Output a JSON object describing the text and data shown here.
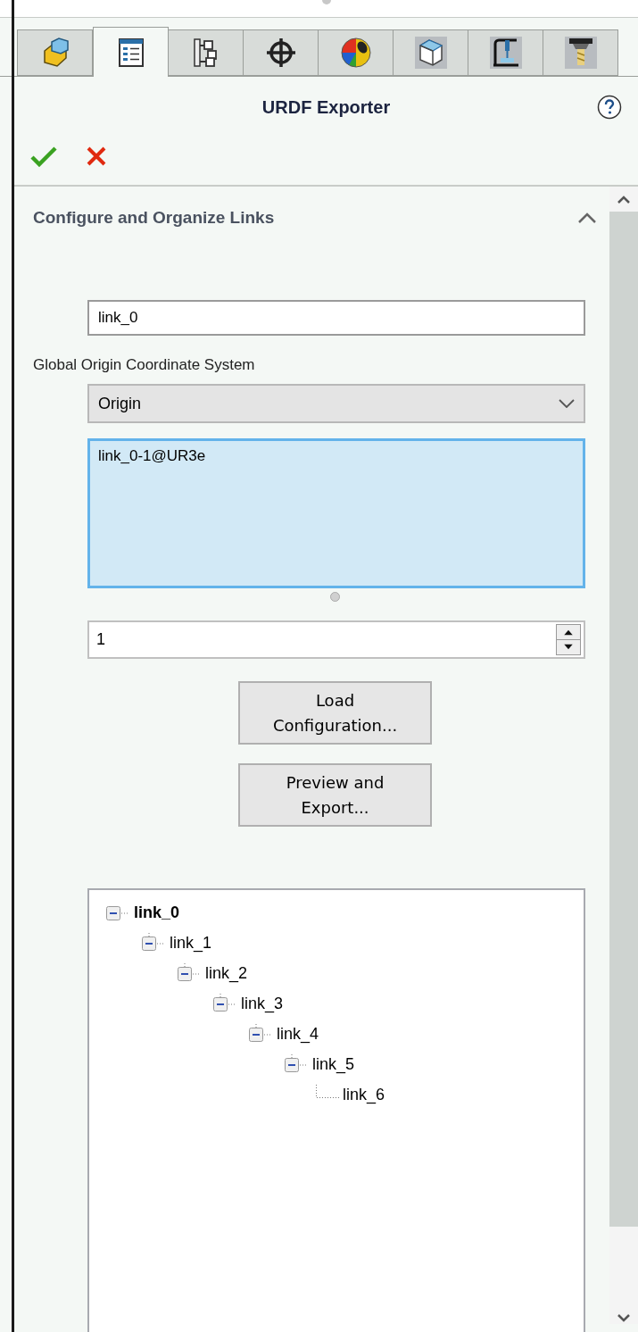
{
  "tabs": [
    {
      "kind": "part",
      "selected": false
    },
    {
      "kind": "property",
      "selected": true
    },
    {
      "kind": "config",
      "selected": false
    },
    {
      "kind": "crosshair",
      "selected": false
    },
    {
      "kind": "appearance",
      "selected": false
    },
    {
      "kind": "cube",
      "selected": false
    },
    {
      "kind": "press",
      "selected": false
    },
    {
      "kind": "drill",
      "selected": false
    }
  ],
  "panel": {
    "title": "URDF Exporter"
  },
  "section": {
    "title": "Configure and Organize Links",
    "expanded": true,
    "link_name": "link_0",
    "origin_label": "Global Origin Coordinate System",
    "origin_select": "Origin",
    "components": [
      "link_0-1@UR3e"
    ],
    "count": "1",
    "buttons": [
      "Load Configuration...",
      "Preview and Export..."
    ],
    "tree": [
      {
        "label": "link_0",
        "expanded": true,
        "children": [
          {
            "label": "link_1",
            "expanded": true,
            "children": [
              {
                "label": "link_2",
                "expanded": true,
                "children": [
                  {
                    "label": "link_3",
                    "expanded": true,
                    "children": [
                      {
                        "label": "link_4",
                        "expanded": true,
                        "children": [
                          {
                            "label": "link_5",
                            "expanded": true,
                            "children": [
                              {
                                "label": "link_6"
                              }
                            ]
                          }
                        ]
                      }
                    ]
                  }
                ]
              }
            ]
          }
        ]
      }
    ]
  }
}
